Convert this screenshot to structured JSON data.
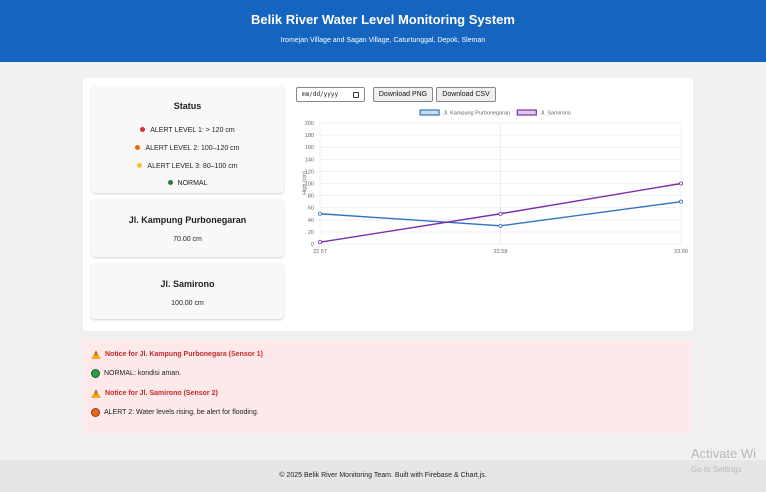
{
  "header": {
    "title": "Belik River Water Level Monitoring System",
    "subtitle": "Iromejan Village and Sagan Village, Caturtunggal, Depok, Sleman"
  },
  "status_card": {
    "title": "Status",
    "levels": [
      {
        "label": "ALERT LEVEL 1: > 120 cm",
        "color": "#d32f2f"
      },
      {
        "label": "ALERT LEVEL 2: 100–120 cm",
        "color": "#ef6c00"
      },
      {
        "label": "ALERT LEVEL 3: 80–100 cm",
        "color": "#fbc02d"
      },
      {
        "label": "NORMAL",
        "color": "#2e7d32"
      }
    ]
  },
  "sensors": [
    {
      "name": "Jl. Kampung Purbonegaran",
      "value": "70.00 cm"
    },
    {
      "name": "Jl. Samirono",
      "value": "100.00 cm"
    }
  ],
  "controls": {
    "date_placeholder": "mm/dd/yyyy",
    "download_png": "Download PNG",
    "download_csv": "Download CSV"
  },
  "chart_data": {
    "type": "line",
    "x": [
      "22.57",
      "22.58",
      "23.00"
    ],
    "ylabel": "High (cm)",
    "ylim": [
      0,
      200
    ],
    "yticks": [
      0,
      20,
      40,
      60,
      80,
      100,
      120,
      140,
      160,
      180,
      200
    ],
    "grid": true,
    "legend_position": "top-center",
    "series": [
      {
        "name": "Jl. Kampung Purbonegaran",
        "values": [
          50,
          30,
          70
        ],
        "color": "#2f74c0"
      },
      {
        "name": "Jl. Samirono",
        "values": [
          3,
          50,
          100
        ],
        "color": "#7b2fa8"
      }
    ]
  },
  "notices": [
    {
      "heading": "Notice for Jl. Kampung Purbonegara (Sensor 1)",
      "message": "NORMAL: kondisi aman.",
      "status_color": "#2e9e3e"
    },
    {
      "heading": "Notice for Jl. Samirono (Sensor 2)",
      "message": "ALERT 2: Water levels rising, be alert for flooding.",
      "status_color": "#e8651a"
    }
  ],
  "footer": {
    "text": "© 2025 Belik River Monitoring Team. Built with Firebase & Chart.js."
  },
  "watermark": {
    "line1": "Activate Wi",
    "line2": "Go to Settings"
  }
}
